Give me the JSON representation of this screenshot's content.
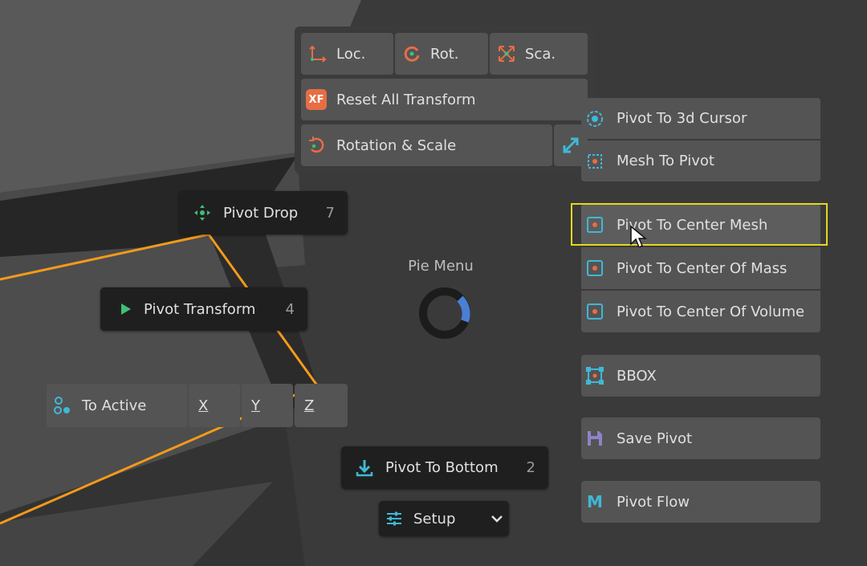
{
  "pie": {
    "title": "Pie Menu",
    "top_panel": {
      "loc_label": "Loc.",
      "rot_label": "Rot.",
      "sca_label": "Sca.",
      "reset_all_label": "Reset All Transform",
      "reset_all_icon_text": "XF",
      "rotation_scale_label": "Rotation & Scale"
    },
    "left": {
      "pivot_drop": {
        "label": "Pivot Drop",
        "hotkey": "7"
      },
      "pivot_transform": {
        "label": "Pivot Transform",
        "hotkey": "4"
      },
      "to_active": {
        "label": "To Active",
        "x": "X",
        "y": "Y",
        "z": "Z"
      }
    },
    "bottom": {
      "pivot_to_bottom": {
        "label": "Pivot To Bottom",
        "hotkey": "2"
      },
      "setup": {
        "label": "Setup"
      }
    },
    "right": {
      "pivot_to_cursor": "Pivot To 3d Cursor",
      "mesh_to_pivot": "Mesh To Pivot",
      "pivot_to_center_mesh": "Pivot To Center Mesh",
      "pivot_to_center_mass": "Pivot To Center Of Mass",
      "pivot_to_center_volume": "Pivot To Center Of Volume",
      "bbox": "BBOX",
      "save_pivot": "Save Pivot",
      "pivot_flow": "Pivot Flow",
      "pivot_flow_icon_text": "M"
    }
  },
  "colors": {
    "highlight": "#e6d81e",
    "selection_edge": "#f39a1a",
    "icon_cyan": "#3fb8d6",
    "icon_orange": "#e76d45",
    "icon_green": "#3fbf76",
    "accent_blue": "#4a7fd4"
  }
}
